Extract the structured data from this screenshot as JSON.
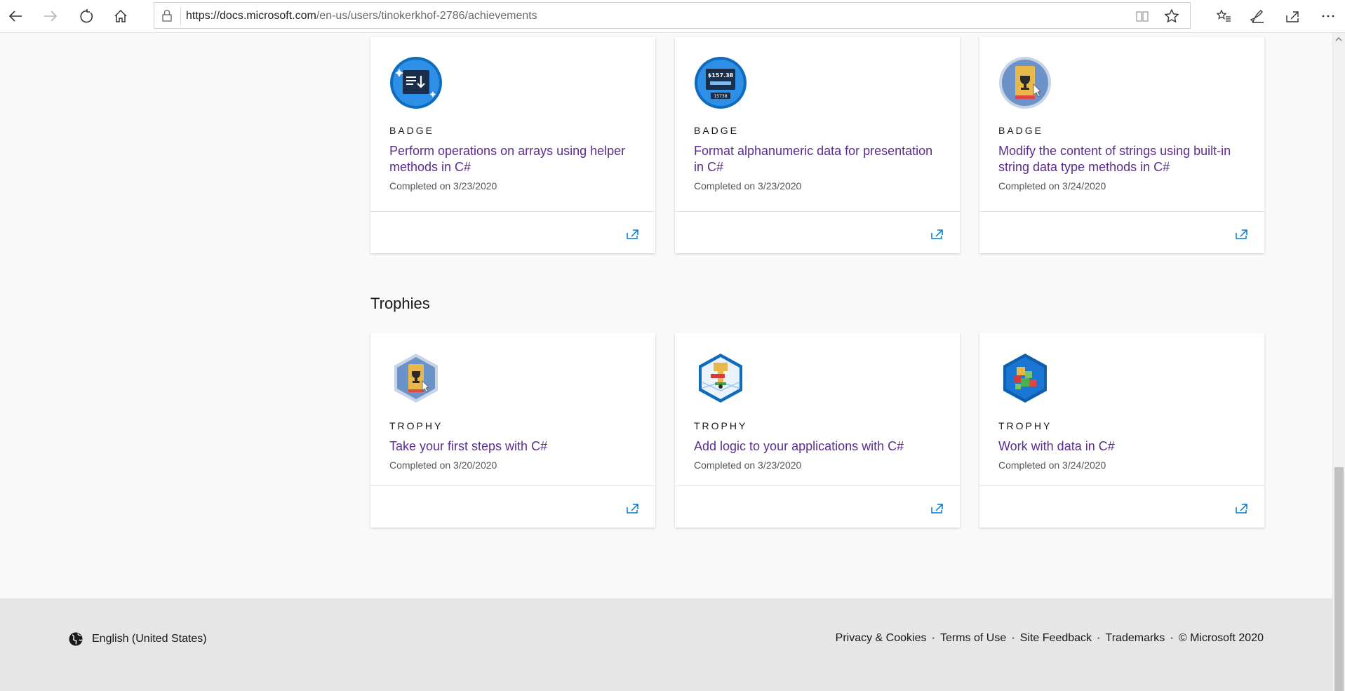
{
  "browser": {
    "url_host": "https://docs.microsoft.com",
    "url_path": "/en-us/users/tinokerkhof-2786/achievements",
    "icons": [
      "back-icon",
      "forward-icon",
      "refresh-icon",
      "home-icon",
      "lock-icon",
      "reading-view-icon",
      "favorite-star-icon",
      "favorites-list-icon",
      "pen-icon",
      "share-icon",
      "more-icon"
    ]
  },
  "badges": [
    {
      "kind": "BADGE",
      "title": "Perform operations on arrays using helper methods in C#",
      "date": "Completed on 3/23/2020"
    },
    {
      "kind": "BADGE",
      "title": "Format alphanumeric data for presentation in C#",
      "date": "Completed on 3/23/2020"
    },
    {
      "kind": "BADGE",
      "title": "Modify the content of strings using built-in string data type methods in C#",
      "date": "Completed on 3/24/2020"
    }
  ],
  "trophies_heading": "Trophies",
  "trophies": [
    {
      "kind": "TROPHY",
      "title": "Take your first steps with C#",
      "date": "Completed on 3/20/2020"
    },
    {
      "kind": "TROPHY",
      "title": "Add logic to your applications with C#",
      "date": "Completed on 3/23/2020"
    },
    {
      "kind": "TROPHY",
      "title": "Work with data in C#",
      "date": "Completed on 3/24/2020"
    }
  ],
  "badge_icon_text": {
    "top": "$157.38",
    "bottom": "15738"
  },
  "footer": {
    "language": "English (United States)",
    "links": [
      "Privacy & Cookies",
      "Terms of Use",
      "Site Feedback",
      "Trademarks"
    ],
    "copyright": "© Microsoft 2020"
  },
  "colors": {
    "link": "#5c2d91",
    "accent": "#0078d4",
    "footer_bg": "#e6e6e6"
  }
}
